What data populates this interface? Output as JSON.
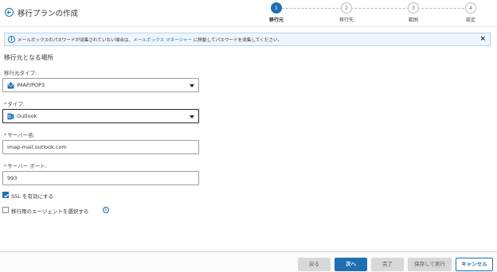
{
  "header": {
    "title": "移行プランの作成"
  },
  "stepper": {
    "steps": [
      {
        "number": "1",
        "label": "移行元",
        "active": true
      },
      {
        "number": "2",
        "label": "移行先",
        "active": false
      },
      {
        "number": "3",
        "label": "範囲",
        "active": false
      },
      {
        "number": "4",
        "label": "設定",
        "active": false
      }
    ]
  },
  "banner": {
    "info_icon": "i",
    "text_before": "メールボックスのパスワードが収集されていない場合は、",
    "link": "メールボックス マネージャー",
    "text_after": " に移動してパスワードを収集してください。",
    "close": "×"
  },
  "form": {
    "section_title": "移行元となる場所",
    "source_type": {
      "label": "移行元タイプ:",
      "value": "IMAP/POP3",
      "icon": "mail-server-icon"
    },
    "type": {
      "required_mark": "*",
      "label": "タイプ:",
      "value": "Outlook",
      "icon": "outlook-icon"
    },
    "server_name": {
      "required_mark": "*",
      "label": "サーバー名:",
      "value": "imap-mail.outlook.com"
    },
    "server_port": {
      "required_mark": "*",
      "label": "サーバー ポート:",
      "value": "993"
    },
    "ssl": {
      "label": "SSL を有効にする",
      "checked": true
    },
    "agent": {
      "label": "移行用のエージェントを選択する",
      "checked": false,
      "help_icon": "i"
    }
  },
  "footer": {
    "back": "戻る",
    "next": "次へ",
    "finish": "完了",
    "save_run": "保存して実行",
    "cancel": "キャンセル"
  },
  "colors": {
    "accent": "#1f6fb2",
    "required": "#dd3333",
    "disabled_button": "#d8d8d8"
  }
}
